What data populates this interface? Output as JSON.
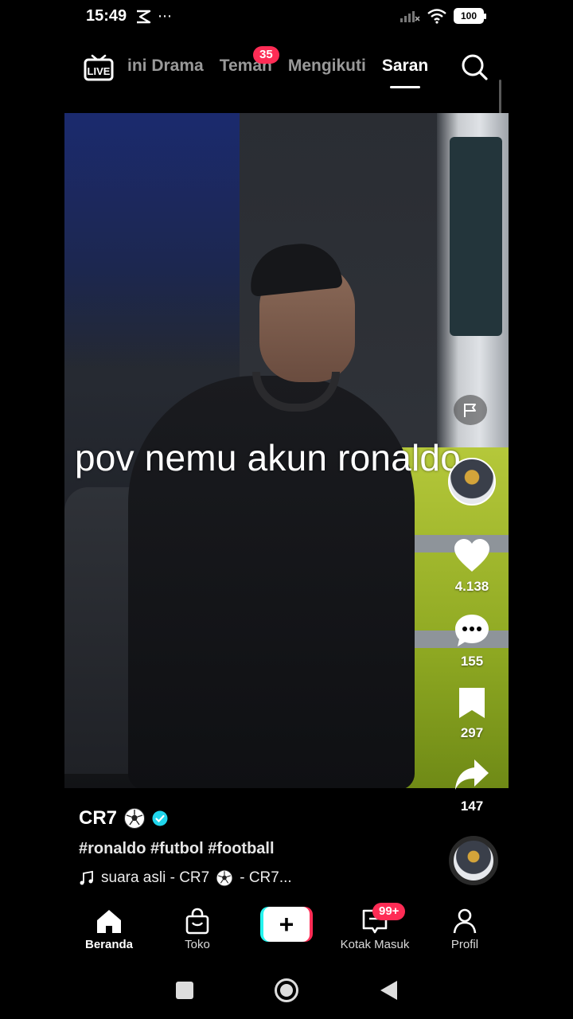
{
  "status_bar": {
    "time": "15:49",
    "extra": "⋯",
    "battery": "100"
  },
  "top_nav": {
    "live_label": "LIVE",
    "tabs": [
      {
        "label": "ini Drama"
      },
      {
        "label": "Teman"
      },
      {
        "label": "Mengikuti"
      },
      {
        "label": "Saran",
        "active": true
      }
    ],
    "teman_badge": "35"
  },
  "video": {
    "overlay_text": "pov nemu akun ronaldo"
  },
  "actions": {
    "likes": "4.138",
    "comments": "155",
    "saves": "297",
    "shares": "147"
  },
  "post": {
    "author": "CR7",
    "hashtags": "#ronaldo #futbol #football",
    "music_prefix": "suara asli - CR7",
    "music_suffix": "- CR7..."
  },
  "bottom_nav": {
    "home": "Beranda",
    "shop": "Toko",
    "inbox": "Kotak Masuk",
    "inbox_badge": "99+",
    "profile": "Profil",
    "create": "+"
  },
  "colors": {
    "accent_red": "#fe2c55",
    "accent_cyan": "#25f4ee",
    "verified": "#20d5ec"
  }
}
